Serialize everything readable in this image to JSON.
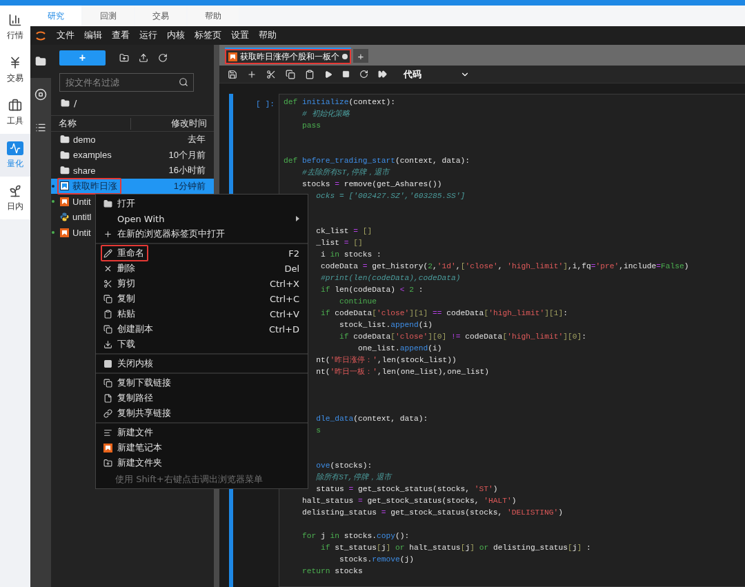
{
  "app_nav": [
    {
      "label": "行情",
      "selected": false
    },
    {
      "label": "交易",
      "selected": false
    },
    {
      "label": "工具",
      "selected": false
    },
    {
      "label": "量化",
      "selected": true
    },
    {
      "label": "日内",
      "selected": false
    }
  ],
  "top_tabs": [
    {
      "label": "研究",
      "selected": true
    },
    {
      "label": "回测",
      "selected": false
    },
    {
      "label": "交易",
      "selected": false
    },
    {
      "label": "帮助",
      "selected": false
    }
  ],
  "menubar": [
    "文件",
    "编辑",
    "查看",
    "运行",
    "内核",
    "标签页",
    "设置",
    "帮助"
  ],
  "file_browser": {
    "new_button": "+",
    "filter": {
      "placeholder": "按文件名过滤"
    },
    "path": "/",
    "columns": [
      "名称",
      "修改时间"
    ],
    "rows": [
      {
        "kind": "folder",
        "name": "demo",
        "modified": "去年",
        "selected": false,
        "running": false,
        "highlighted": false
      },
      {
        "kind": "folder",
        "name": "examples",
        "modified": "10个月前",
        "selected": false,
        "running": false,
        "highlighted": false
      },
      {
        "kind": "folder",
        "name": "share",
        "modified": "16小时前",
        "selected": false,
        "running": false,
        "highlighted": false
      },
      {
        "kind": "notebook",
        "name": "获取昨日涨",
        "modified": "1分钟前",
        "selected": true,
        "running": true,
        "highlighted": true
      },
      {
        "kind": "notebook",
        "name": "Untit",
        "selected": false,
        "running": true,
        "highlighted": false
      },
      {
        "kind": "python",
        "name": "untitl",
        "selected": false,
        "running": false,
        "highlighted": false
      },
      {
        "kind": "notebook",
        "name": "Untit",
        "selected": false,
        "running": true,
        "highlighted": false
      }
    ]
  },
  "editor": {
    "tab": {
      "title": "获取昨日涨停个股和一板个",
      "modified": true,
      "highlighted": true
    },
    "add_tab": "+",
    "cell_type": "代码",
    "prompt": "[ ]:",
    "lines": [
      {
        "kind": "code",
        "segments": [
          {
            "kind": "kw",
            "text": "def "
          },
          {
            "kind": "fn",
            "text": "initialize"
          },
          {
            "kind": "tx",
            "text": "(context):"
          }
        ]
      },
      {
        "kind": "code",
        "segments": [
          {
            "kind": "cm",
            "text": "    # 初始化策略"
          }
        ]
      },
      {
        "kind": "code",
        "segments": [
          {
            "kind": "kw",
            "text": "    pass"
          }
        ]
      },
      {
        "kind": "blank"
      },
      {
        "kind": "blank"
      },
      {
        "kind": "code",
        "segments": [
          {
            "kind": "kw",
            "text": "def "
          },
          {
            "kind": "fn",
            "text": "before_trading_start"
          },
          {
            "kind": "tx",
            "text": "(context, data):"
          }
        ]
      },
      {
        "kind": "code",
        "segments": [
          {
            "kind": "cm",
            "text": "    #去除所有ST,停牌，退市"
          }
        ]
      },
      {
        "kind": "code",
        "segments": [
          {
            "kind": "tx",
            "text": "    stocks "
          },
          {
            "kind": "op",
            "text": "="
          },
          {
            "kind": "tx",
            "text": " remove(get_Ashares())"
          }
        ]
      },
      {
        "kind": "code",
        "segments": [
          {
            "kind": "cm",
            "text": "       ocks = ['002427.SZ','603285.SS']"
          }
        ]
      },
      {
        "kind": "blank"
      },
      {
        "kind": "blank"
      },
      {
        "kind": "code",
        "segments": [
          {
            "kind": "tx",
            "text": "       ck_list "
          },
          {
            "kind": "op",
            "text": "="
          },
          {
            "kind": "br",
            "text": " []"
          }
        ]
      },
      {
        "kind": "code",
        "segments": [
          {
            "kind": "tx",
            "text": "       _list "
          },
          {
            "kind": "op",
            "text": "="
          },
          {
            "kind": "br",
            "text": " []"
          }
        ]
      },
      {
        "kind": "code",
        "segments": [
          {
            "kind": "tx",
            "text": "        i "
          },
          {
            "kind": "kw",
            "text": "in"
          },
          {
            "kind": "tx",
            "text": " stocks :"
          }
        ]
      },
      {
        "kind": "code",
        "segments": [
          {
            "kind": "tx",
            "text": "        codeData "
          },
          {
            "kind": "op",
            "text": "="
          },
          {
            "kind": "tx",
            "text": " get_history("
          },
          {
            "kind": "num",
            "text": "2"
          },
          {
            "kind": "tx",
            "text": ","
          },
          {
            "kind": "str",
            "text": "'1d'"
          },
          {
            "kind": "tx",
            "text": ","
          },
          {
            "kind": "br",
            "text": "["
          },
          {
            "kind": "str",
            "text": "'close'"
          },
          {
            "kind": "tx",
            "text": ", "
          },
          {
            "kind": "str",
            "text": "'high_limit'"
          },
          {
            "kind": "br",
            "text": "]"
          },
          {
            "kind": "tx",
            "text": ",i,fq"
          },
          {
            "kind": "op",
            "text": "="
          },
          {
            "kind": "str",
            "text": "'pre'"
          },
          {
            "kind": "tx",
            "text": ",include"
          },
          {
            "kind": "op",
            "text": "="
          },
          {
            "kind": "kw",
            "text": "False"
          },
          {
            "kind": "tx",
            "text": ")"
          }
        ]
      },
      {
        "kind": "code",
        "segments": [
          {
            "kind": "cm",
            "text": "        #print(len(codeData),codeData)"
          }
        ]
      },
      {
        "kind": "code",
        "segments": [
          {
            "kind": "kw",
            "text": "        if"
          },
          {
            "kind": "tx",
            "text": " len(codeData) "
          },
          {
            "kind": "op",
            "text": "<"
          },
          {
            "kind": "num",
            "text": " 2"
          },
          {
            "kind": "tx",
            "text": " :"
          }
        ]
      },
      {
        "kind": "code",
        "segments": [
          {
            "kind": "kw",
            "text": "            continue"
          }
        ]
      },
      {
        "kind": "code",
        "segments": [
          {
            "kind": "kw",
            "text": "        if"
          },
          {
            "kind": "tx",
            "text": " codeData"
          },
          {
            "kind": "br",
            "text": "["
          },
          {
            "kind": "str",
            "text": "'close'"
          },
          {
            "kind": "br",
            "text": "][1]"
          },
          {
            "kind": "op",
            "text": " =="
          },
          {
            "kind": "tx",
            "text": " codeData"
          },
          {
            "kind": "br",
            "text": "["
          },
          {
            "kind": "str",
            "text": "'high_limit'"
          },
          {
            "kind": "br",
            "text": "][1]"
          },
          {
            "kind": "tx",
            "text": ":"
          }
        ]
      },
      {
        "kind": "code",
        "segments": [
          {
            "kind": "tx",
            "text": "            stock_list."
          },
          {
            "kind": "fn",
            "text": "append"
          },
          {
            "kind": "tx",
            "text": "(i)"
          }
        ]
      },
      {
        "kind": "code",
        "segments": [
          {
            "kind": "kw",
            "text": "            if"
          },
          {
            "kind": "tx",
            "text": " codeData"
          },
          {
            "kind": "br",
            "text": "["
          },
          {
            "kind": "str",
            "text": "'close'"
          },
          {
            "kind": "br",
            "text": "][0]"
          },
          {
            "kind": "op",
            "text": " !="
          },
          {
            "kind": "tx",
            "text": " codeData"
          },
          {
            "kind": "br",
            "text": "["
          },
          {
            "kind": "str",
            "text": "'high_limit'"
          },
          {
            "kind": "br",
            "text": "][0]"
          },
          {
            "kind": "tx",
            "text": ":"
          }
        ]
      },
      {
        "kind": "code",
        "segments": [
          {
            "kind": "tx",
            "text": "                one_list."
          },
          {
            "kind": "fn",
            "text": "append"
          },
          {
            "kind": "tx",
            "text": "(i)"
          }
        ]
      },
      {
        "kind": "code",
        "segments": [
          {
            "kind": "tx",
            "text": "       nt("
          },
          {
            "kind": "str",
            "text": "'昨日涨停：'"
          },
          {
            "kind": "tx",
            "text": ",len(stock_list))"
          }
        ]
      },
      {
        "kind": "code",
        "segments": [
          {
            "kind": "tx",
            "text": "       nt("
          },
          {
            "kind": "str",
            "text": "'昨日一板：'"
          },
          {
            "kind": "tx",
            "text": ",len(one_list),one_list)"
          }
        ]
      },
      {
        "kind": "blank"
      },
      {
        "kind": "blank"
      },
      {
        "kind": "blank"
      },
      {
        "kind": "code",
        "segments": [
          {
            "kind": "fn",
            "text": "       dle_data"
          },
          {
            "kind": "tx",
            "text": "(context, data):"
          }
        ]
      },
      {
        "kind": "code",
        "segments": [
          {
            "kind": "kw",
            "text": "       s"
          }
        ]
      },
      {
        "kind": "blank"
      },
      {
        "kind": "blank"
      },
      {
        "kind": "code",
        "segments": [
          {
            "kind": "fn",
            "text": "       ove"
          },
          {
            "kind": "tx",
            "text": "(stocks):"
          }
        ]
      },
      {
        "kind": "code",
        "segments": [
          {
            "kind": "cm",
            "text": "       除所有ST,停牌，退市"
          }
        ]
      },
      {
        "kind": "code",
        "segments": [
          {
            "kind": "tx",
            "text": "       status "
          },
          {
            "kind": "op",
            "text": "="
          },
          {
            "kind": "tx",
            "text": " get_stock_status(stocks, "
          },
          {
            "kind": "str",
            "text": "'ST'"
          },
          {
            "kind": "tx",
            "text": ")"
          }
        ]
      },
      {
        "kind": "code",
        "segments": [
          {
            "kind": "tx",
            "text": "    halt_status "
          },
          {
            "kind": "op",
            "text": "="
          },
          {
            "kind": "tx",
            "text": " get_stock_status(stocks, "
          },
          {
            "kind": "str",
            "text": "'HALT'"
          },
          {
            "kind": "tx",
            "text": ")"
          }
        ]
      },
      {
        "kind": "code",
        "segments": [
          {
            "kind": "tx",
            "text": "    delisting_status "
          },
          {
            "kind": "op",
            "text": "="
          },
          {
            "kind": "tx",
            "text": " get_stock_status(stocks, "
          },
          {
            "kind": "str",
            "text": "'DELISTING'"
          },
          {
            "kind": "tx",
            "text": ")"
          }
        ]
      },
      {
        "kind": "blank"
      },
      {
        "kind": "code",
        "segments": [
          {
            "kind": "kw",
            "text": "    for"
          },
          {
            "kind": "tx",
            "text": " j "
          },
          {
            "kind": "kw",
            "text": "in"
          },
          {
            "kind": "tx",
            "text": " stocks."
          },
          {
            "kind": "fn",
            "text": "copy"
          },
          {
            "kind": "tx",
            "text": "():"
          }
        ]
      },
      {
        "kind": "code",
        "segments": [
          {
            "kind": "kw",
            "text": "        if"
          },
          {
            "kind": "tx",
            "text": " st_status"
          },
          {
            "kind": "br",
            "text": "["
          },
          {
            "kind": "tx",
            "text": "j"
          },
          {
            "kind": "br",
            "text": "]"
          },
          {
            "kind": "kw",
            "text": " or"
          },
          {
            "kind": "tx",
            "text": " halt_status"
          },
          {
            "kind": "br",
            "text": "["
          },
          {
            "kind": "tx",
            "text": "j"
          },
          {
            "kind": "br",
            "text": "]"
          },
          {
            "kind": "kw",
            "text": " or"
          },
          {
            "kind": "tx",
            "text": " delisting_status"
          },
          {
            "kind": "br",
            "text": "["
          },
          {
            "kind": "tx",
            "text": "j"
          },
          {
            "kind": "br",
            "text": "]"
          },
          {
            "kind": "tx",
            "text": " :"
          }
        ]
      },
      {
        "kind": "code",
        "segments": [
          {
            "kind": "tx",
            "text": "            stocks."
          },
          {
            "kind": "fn",
            "text": "remove"
          },
          {
            "kind": "tx",
            "text": "(j)"
          }
        ]
      },
      {
        "kind": "code",
        "segments": [
          {
            "kind": "kw",
            "text": "    return"
          },
          {
            "kind": "tx",
            "text": " stocks"
          }
        ]
      }
    ]
  },
  "context_menu": {
    "groups": [
      [
        {
          "label": "打开",
          "submenu": false,
          "highlighted": false
        },
        {
          "label": "Open With",
          "submenu": true,
          "highlighted": false
        },
        {
          "label": "在新的浏览器标签页中打开",
          "submenu": false,
          "highlighted": false
        }
      ],
      [
        {
          "label": "重命名",
          "shortcut": "F2",
          "submenu": false,
          "highlighted": true
        },
        {
          "label": "删除",
          "shortcut": "Del",
          "submenu": false,
          "highlighted": false
        },
        {
          "label": "剪切",
          "shortcut": "Ctrl+X",
          "submenu": false,
          "highlighted": false
        },
        {
          "label": "复制",
          "shortcut": "Ctrl+C",
          "submenu": false,
          "highlighted": false
        },
        {
          "label": "粘贴",
          "shortcut": "Ctrl+V",
          "submenu": false,
          "highlighted": false
        },
        {
          "label": "创建副本",
          "shortcut": "Ctrl+D",
          "submenu": false,
          "highlighted": false
        },
        {
          "label": "下载",
          "submenu": false,
          "highlighted": false
        }
      ],
      [
        {
          "label": "关闭内核",
          "submenu": false,
          "highlighted": false
        }
      ],
      [
        {
          "label": "复制下载链接",
          "submenu": false,
          "highlighted": false
        },
        {
          "label": "复制路径",
          "submenu": false,
          "highlighted": false
        },
        {
          "label": "复制共享链接",
          "submenu": false,
          "highlighted": false
        }
      ],
      [
        {
          "label": "新建文件",
          "submenu": false,
          "highlighted": false
        },
        {
          "label": "新建笔记本",
          "submenu": false,
          "highlighted": false
        },
        {
          "label": "新建文件夹",
          "submenu": false,
          "highlighted": false
        }
      ]
    ],
    "hint": "使用 Shift+右键点击调出浏览器菜单"
  }
}
